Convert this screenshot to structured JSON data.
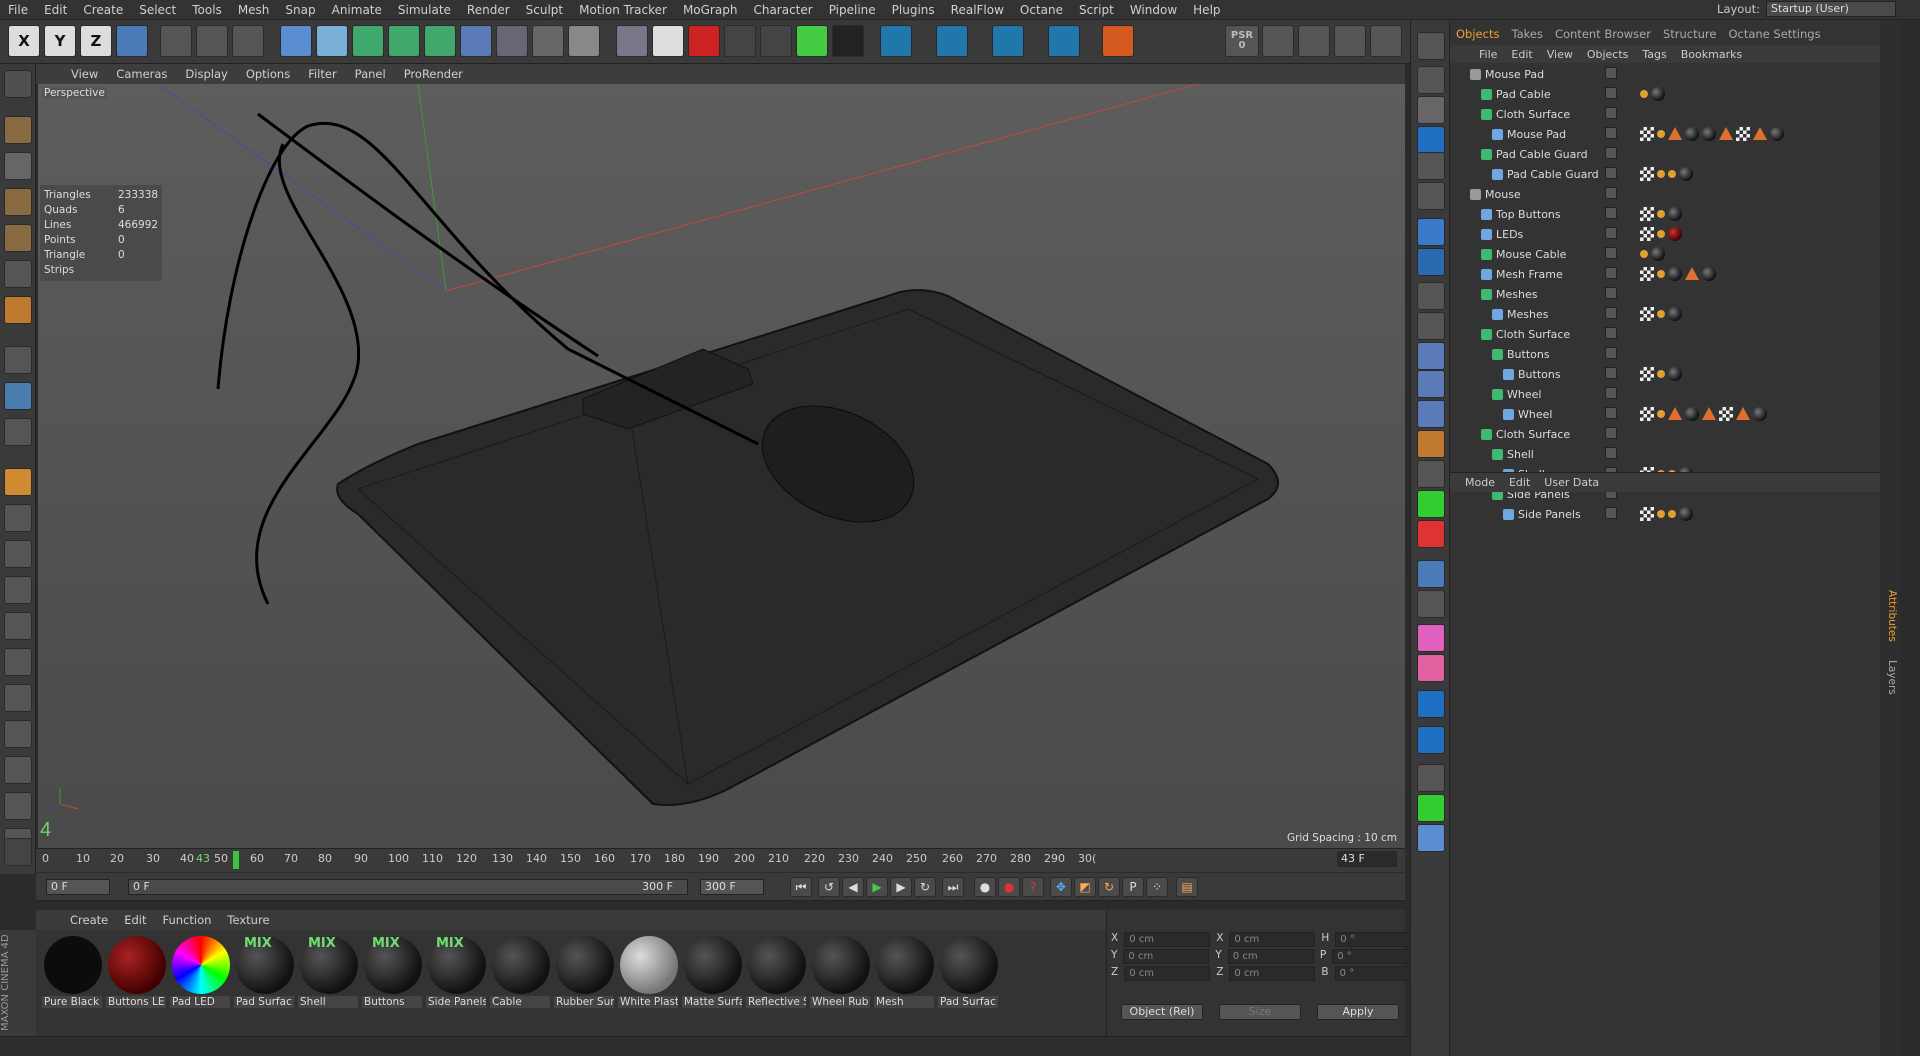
{
  "menubar": {
    "items": [
      "File",
      "Edit",
      "Create",
      "Select",
      "Tools",
      "Mesh",
      "Snap",
      "Animate",
      "Simulate",
      "Render",
      "Sculpt",
      "Motion Tracker",
      "MoGraph",
      "Character",
      "Pipeline",
      "Plugins",
      "RealFlow",
      "Octane",
      "Script",
      "Window",
      "Help"
    ],
    "layout_label": "Layout:",
    "layout_value": "Startup (User)"
  },
  "toolbar": {
    "axis_x": "X",
    "axis_y": "Y",
    "axis_z": "Z",
    "psr_label": "PSR",
    "psr_value": "0"
  },
  "viewport": {
    "menu": [
      "View",
      "Cameras",
      "Display",
      "Options",
      "Filter",
      "Panel",
      "ProRender"
    ],
    "label": "Perspective",
    "stats": [
      {
        "k": "Triangles",
        "v": "233338"
      },
      {
        "k": "Quads",
        "v": "6"
      },
      {
        "k": "Lines",
        "v": "466992"
      },
      {
        "k": "Points",
        "v": "0"
      },
      {
        "k": "Triangle Strips",
        "v": "0"
      }
    ],
    "grid_spacing": "Grid Spacing : 10 cm"
  },
  "timeline": {
    "ticks": [
      "0",
      "10",
      "20",
      "30",
      "40",
      "43",
      "50",
      "60",
      "70",
      "80",
      "90",
      "100",
      "110",
      "120",
      "130",
      "140",
      "150",
      "160",
      "170",
      "180",
      "190",
      "200",
      "210",
      "220",
      "230",
      "240",
      "250",
      "260",
      "270",
      "280",
      "290",
      "30("
    ],
    "current_frame": "43 F"
  },
  "transport": {
    "start": "0 F",
    "range_start": "0 F",
    "range_end": "300 F",
    "end": "300 F"
  },
  "materials": {
    "menu": [
      "Create",
      "Edit",
      "Function",
      "Texture"
    ],
    "items": [
      {
        "label": "Pure Black",
        "mix": "",
        "color": "#111111"
      },
      {
        "label": "Buttons LE",
        "mix": "",
        "color": "#6a0a0a"
      },
      {
        "label": "Pad LED",
        "mix": "",
        "color": "rainbow"
      },
      {
        "label": "Pad Surfac",
        "mix": "MIX",
        "color": "#2a2a2a"
      },
      {
        "label": "Shell",
        "mix": "MIX",
        "color": "#2a2a2a"
      },
      {
        "label": "Buttons",
        "mix": "MIX",
        "color": "#2a2a2a"
      },
      {
        "label": "Side Panels",
        "mix": "MIX",
        "color": "#2a2a2a"
      },
      {
        "label": "Cable",
        "mix": "",
        "color": "#2a2a2a"
      },
      {
        "label": "Rubber Sur",
        "mix": "",
        "color": "#222222"
      },
      {
        "label": "White Plast",
        "mix": "",
        "color": "#aaaaaa"
      },
      {
        "label": "Matte Surfa",
        "mix": "",
        "color": "#2a2a2a"
      },
      {
        "label": "Reflective S",
        "mix": "",
        "color": "#222222"
      },
      {
        "label": "Wheel Rub",
        "mix": "",
        "color": "#1a1a1a"
      },
      {
        "label": "Mesh",
        "mix": "",
        "color": "#222222"
      },
      {
        "label": "Pad Surfac",
        "mix": "",
        "color": "#2a2a2a"
      }
    ]
  },
  "coords": {
    "rows": [
      {
        "a": "X",
        "av": "0 cm",
        "b": "X",
        "bv": "0 cm",
        "c": "H",
        "cv": "0 °"
      },
      {
        "a": "Y",
        "av": "0 cm",
        "b": "Y",
        "bv": "0 cm",
        "c": "P",
        "cv": "0 °"
      },
      {
        "a": "Z",
        "av": "0 cm",
        "b": "Z",
        "bv": "0 cm",
        "c": "B",
        "cv": "0 °"
      }
    ],
    "mode": "Object (Rel)",
    "size": "Size",
    "apply": "Apply"
  },
  "brand": "MAXON CINEMA 4D",
  "objects_panel": {
    "tabs": [
      "Objects",
      "Takes",
      "Content Browser",
      "Structure",
      "Octane Settings"
    ],
    "menu": [
      "File",
      "Edit",
      "View",
      "Objects",
      "Tags",
      "Bookmarks"
    ],
    "rows": [
      {
        "name": "Mouse Pad",
        "depth": 0,
        "icon": "null",
        "tags": []
      },
      {
        "name": "Pad Cable",
        "depth": 1,
        "icon": "green",
        "tags": [
          "dot",
          "ball"
        ]
      },
      {
        "name": "Cloth Surface",
        "depth": 1,
        "icon": "green",
        "tags": []
      },
      {
        "name": "Mouse Pad",
        "depth": 2,
        "icon": "blue",
        "tags": [
          "chk",
          "dot",
          "tri",
          "ball",
          "ball",
          "tri",
          "chk",
          "tri",
          "ball"
        ]
      },
      {
        "name": "Pad Cable Guard",
        "depth": 1,
        "icon": "green",
        "tags": []
      },
      {
        "name": "Pad Cable Guard",
        "depth": 2,
        "icon": "blue",
        "tags": [
          "chk",
          "dot",
          "dot",
          "ball"
        ]
      },
      {
        "name": "Mouse",
        "depth": 0,
        "icon": "null",
        "tags": []
      },
      {
        "name": "Top Buttons",
        "depth": 1,
        "icon": "blue",
        "tags": [
          "chk",
          "dot",
          "ball"
        ]
      },
      {
        "name": "LEDs",
        "depth": 1,
        "icon": "blue",
        "tags": [
          "chk",
          "dot",
          "red"
        ]
      },
      {
        "name": "Mouse Cable",
        "depth": 1,
        "icon": "green",
        "tags": [
          "dot",
          "ball"
        ]
      },
      {
        "name": "Mesh Frame",
        "depth": 1,
        "icon": "blue",
        "tags": [
          "chk",
          "dot",
          "ball",
          "tri",
          "ball"
        ]
      },
      {
        "name": "Meshes",
        "depth": 1,
        "icon": "green",
        "tags": []
      },
      {
        "name": "Meshes",
        "depth": 2,
        "icon": "blue",
        "tags": [
          "chk",
          "dot",
          "ball"
        ]
      },
      {
        "name": "Cloth Surface",
        "depth": 1,
        "icon": "green",
        "tags": []
      },
      {
        "name": "Buttons",
        "depth": 2,
        "icon": "green",
        "tags": []
      },
      {
        "name": "Buttons",
        "depth": 3,
        "icon": "blue",
        "tags": [
          "chk",
          "dot",
          "ball"
        ]
      },
      {
        "name": "Wheel",
        "depth": 2,
        "icon": "green",
        "tags": []
      },
      {
        "name": "Wheel",
        "depth": 3,
        "icon": "blue",
        "tags": [
          "chk",
          "dot",
          "tri",
          "ball",
          "tri",
          "chk",
          "tri",
          "ball"
        ]
      },
      {
        "name": "Cloth Surface",
        "depth": 1,
        "icon": "green",
        "tags": []
      },
      {
        "name": "Shell",
        "depth": 2,
        "icon": "green",
        "tags": []
      },
      {
        "name": "Shell",
        "depth": 3,
        "icon": "blue",
        "tags": [
          "chk",
          "dot",
          "dot",
          "ball"
        ]
      },
      {
        "name": "Side Panels",
        "depth": 2,
        "icon": "green",
        "tags": []
      },
      {
        "name": "Side Panels",
        "depth": 3,
        "icon": "blue",
        "tags": [
          "chk",
          "dot",
          "dot",
          "ball"
        ]
      }
    ]
  },
  "attributes": {
    "menu": [
      "Mode",
      "Edit",
      "User Data"
    ],
    "side_tabs": [
      "Attributes",
      "Layers"
    ]
  }
}
